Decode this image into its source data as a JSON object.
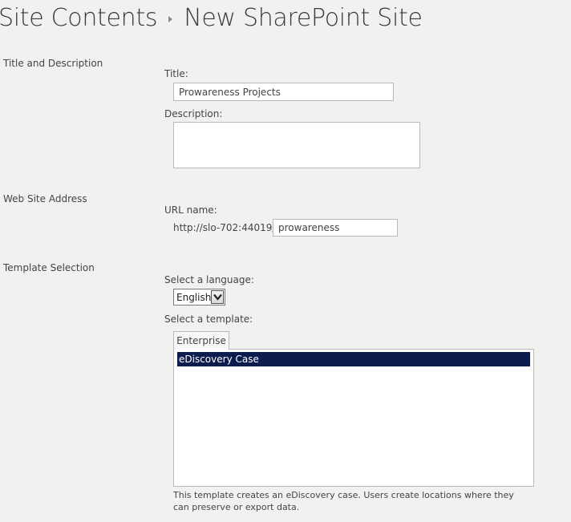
{
  "breadcrumb": {
    "parent": "Site Contents",
    "current": "New SharePoint Site"
  },
  "sections": {
    "title_description": {
      "heading": "Title and Description",
      "title_label": "Title:",
      "title_value": "Prowareness Projects",
      "description_label": "Description:",
      "description_value": ""
    },
    "web_address": {
      "heading": "Web Site Address",
      "url_label": "URL name:",
      "url_prefix": "http://slo-702:44019/",
      "url_value": "prowareness"
    },
    "template": {
      "heading": "Template Selection",
      "language_label": "Select a language:",
      "language_value": "English",
      "template_label": "Select a template:",
      "tabs": [
        {
          "label": "Enterprise"
        }
      ],
      "items": [
        {
          "label": "eDiscovery Case",
          "selected": true
        }
      ],
      "description": "This template creates an eDiscovery case. Users create locations where they can preserve or export data."
    }
  },
  "colors": {
    "background": "#f2f1f0",
    "selection": "#0c1c4f"
  },
  "icons": {
    "breadcrumb_separator": "chevron-right-icon",
    "dropdown": "chevron-down-icon"
  }
}
